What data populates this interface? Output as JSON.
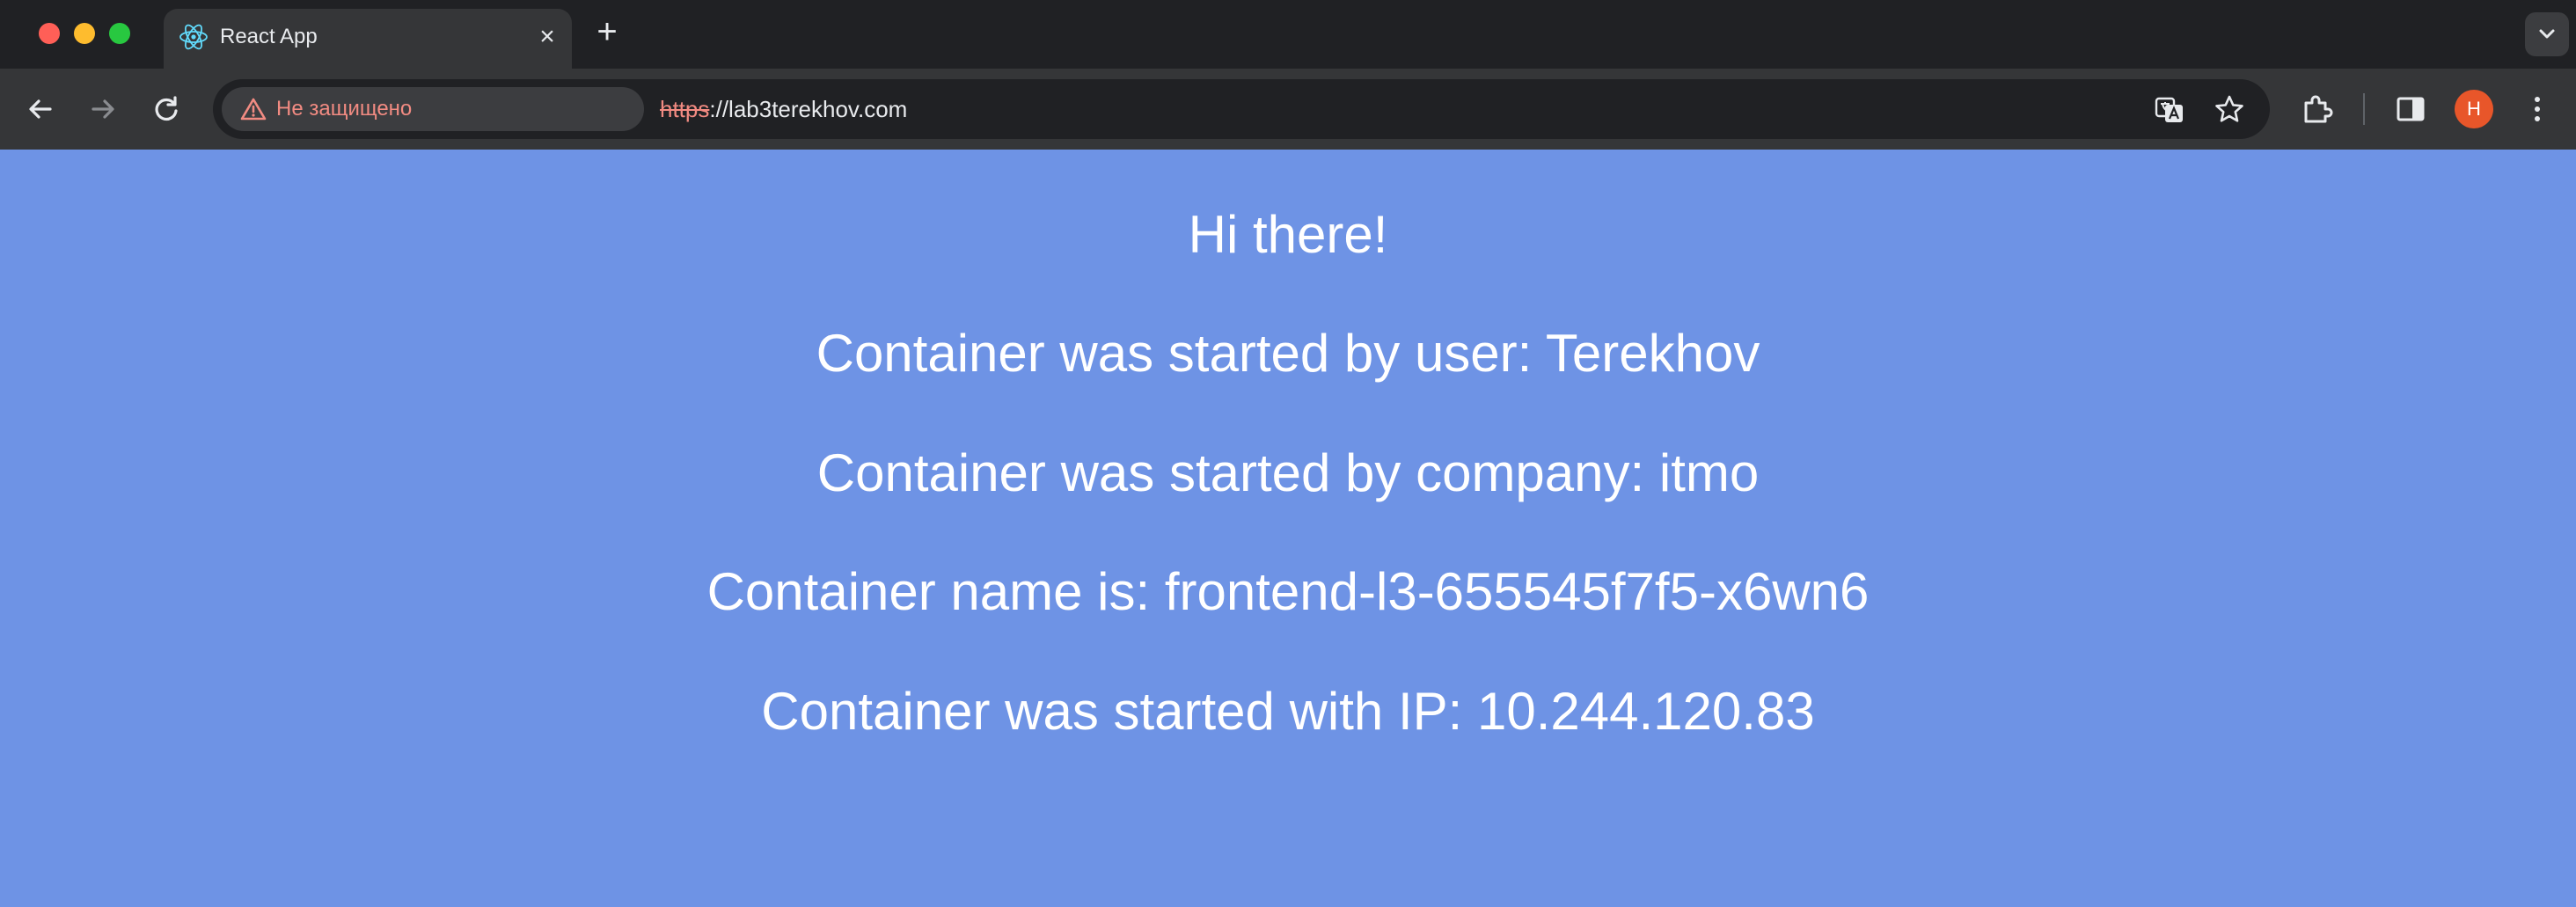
{
  "browser": {
    "tab": {
      "title": "React App",
      "favicon": "react-logo-icon",
      "close": "×"
    },
    "new_tab": "+",
    "toolbar": {
      "security_label": "Не защищено",
      "url_scheme": "https",
      "url_rest": "://lab3terekhov.com",
      "profile_initial": "H"
    },
    "colors": {
      "chrome_dark": "#202124",
      "toolbar": "#353638",
      "warning": "#f28b82",
      "avatar": "#e8562a"
    }
  },
  "page": {
    "background": "#6e93e5",
    "greeting": "Hi there!",
    "user_line": "Container was started by user: Terekhov",
    "company_line": "Container was started by company: itmo",
    "name_line": "Container name is: frontend-l3-655545f7f5-x6wn6",
    "ip_line": "Container was started with IP: 10.244.120.83"
  }
}
